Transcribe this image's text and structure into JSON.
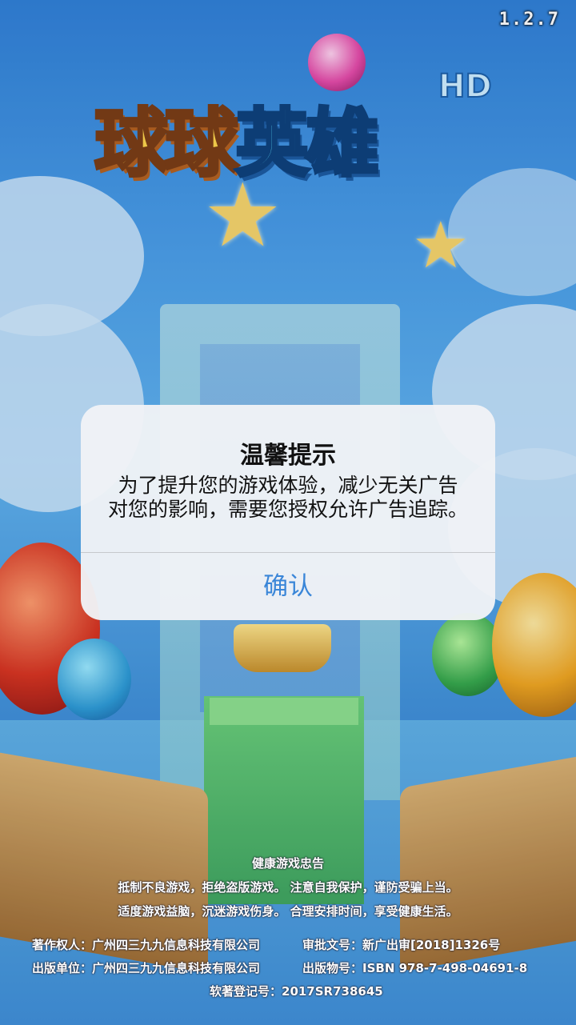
{
  "version": "1.2.7",
  "logo": {
    "part1": "球球",
    "part2": "英雄",
    "hd": "HD"
  },
  "alert": {
    "title": "温馨提示",
    "message_line1": "为了提升您的游戏体验，减少无关广告",
    "message_line2": "对您的影响，需要您授权允许广告追踪。",
    "confirm_label": "确认"
  },
  "health_notice": {
    "title": "健康游戏忠告",
    "line1": "抵制不良游戏，拒绝盗版游戏。 注意自我保护，谨防受骗上当。",
    "line2": "适度游戏益脑，沉迷游戏伤身。 合理安排时间，享受健康生活。"
  },
  "publishing_info": {
    "copyright_owner": "著作权人：广州四三九九信息科技有限公司",
    "approval_no": "审批文号：新广出审[2018]1326号",
    "publisher": "出版单位：广州四三九九信息科技有限公司",
    "isbn": "出版物号：ISBN 978-7-498-04691-8",
    "software_reg": "软著登记号：2017SR738645"
  },
  "colors": {
    "accent": "#3a86d8"
  }
}
